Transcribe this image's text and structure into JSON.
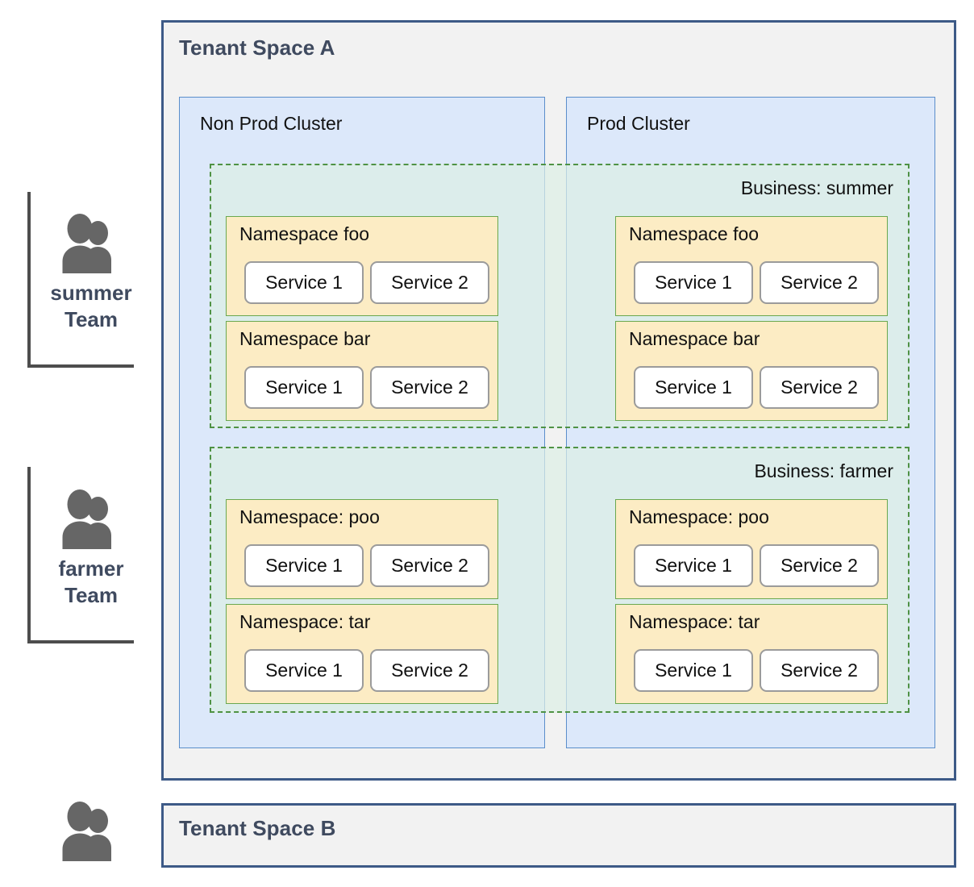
{
  "teams": [
    {
      "name": "summer",
      "suffix": "Team",
      "icon": "people-icon"
    },
    {
      "name": "farmer",
      "suffix": "Team",
      "icon": "people-icon"
    }
  ],
  "tenants": [
    {
      "title": "Tenant Space A"
    },
    {
      "title": "Tenant Space B"
    }
  ],
  "tenant_b_icon": "people-icon",
  "clusters": [
    {
      "title": "Non Prod Cluster"
    },
    {
      "title": "Prod Cluster"
    }
  ],
  "businesses": [
    {
      "label": "Business: summer",
      "namespaces_nonprod": [
        {
          "title": "Namespace foo",
          "services": [
            "Service 1",
            "Service 2"
          ]
        },
        {
          "title": "Namespace bar",
          "services": [
            "Service 1",
            "Service 2"
          ]
        }
      ],
      "namespaces_prod": [
        {
          "title": "Namespace foo",
          "services": [
            "Service 1",
            "Service 2"
          ]
        },
        {
          "title": "Namespace bar",
          "services": [
            "Service 1",
            "Service 2"
          ]
        }
      ]
    },
    {
      "label": "Business: farmer",
      "namespaces_nonprod": [
        {
          "title": "Namespace: poo",
          "services": [
            "Service 1",
            "Service 2"
          ]
        },
        {
          "title": "Namespace: tar",
          "services": [
            "Service 1",
            "Service 2"
          ]
        }
      ],
      "namespaces_prod": [
        {
          "title": "Namespace: poo",
          "services": [
            "Service 1",
            "Service 2"
          ]
        },
        {
          "title": "Namespace: tar",
          "services": [
            "Service 1",
            "Service 2"
          ]
        }
      ]
    }
  ],
  "colors": {
    "tenant_border": "#3d5a87",
    "tenant_fill": "#f2f2f2",
    "tenant_title": "#3f4a5f",
    "cluster_border": "#5b8ecb",
    "cluster_fill": "#dce8fa",
    "business_border": "#4f9244",
    "business_fill": "#ddeee4",
    "namespace_border": "#6aa84f",
    "namespace_fill": "#fcecc4",
    "service_border": "#9b9b9b",
    "service_fill": "#ffffff",
    "icon_gray": "#666666",
    "bracket_gray": "#4d4d4d"
  }
}
